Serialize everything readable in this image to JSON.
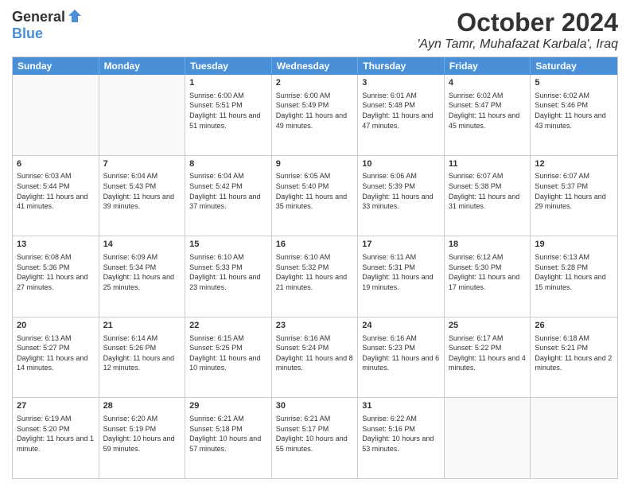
{
  "logo": {
    "general": "General",
    "blue": "Blue"
  },
  "header": {
    "month": "October 2024",
    "location": "'Ayn Tamr, Muhafazat Karbala', Iraq"
  },
  "days": [
    "Sunday",
    "Monday",
    "Tuesday",
    "Wednesday",
    "Thursday",
    "Friday",
    "Saturday"
  ],
  "rows": [
    [
      {
        "day": "",
        "info": "",
        "empty": true
      },
      {
        "day": "",
        "info": "",
        "empty": true
      },
      {
        "day": "1",
        "info": "Sunrise: 6:00 AM\nSunset: 5:51 PM\nDaylight: 11 hours and 51 minutes."
      },
      {
        "day": "2",
        "info": "Sunrise: 6:00 AM\nSunset: 5:49 PM\nDaylight: 11 hours and 49 minutes."
      },
      {
        "day": "3",
        "info": "Sunrise: 6:01 AM\nSunset: 5:48 PM\nDaylight: 11 hours and 47 minutes."
      },
      {
        "day": "4",
        "info": "Sunrise: 6:02 AM\nSunset: 5:47 PM\nDaylight: 11 hours and 45 minutes."
      },
      {
        "day": "5",
        "info": "Sunrise: 6:02 AM\nSunset: 5:46 PM\nDaylight: 11 hours and 43 minutes."
      }
    ],
    [
      {
        "day": "6",
        "info": "Sunrise: 6:03 AM\nSunset: 5:44 PM\nDaylight: 11 hours and 41 minutes."
      },
      {
        "day": "7",
        "info": "Sunrise: 6:04 AM\nSunset: 5:43 PM\nDaylight: 11 hours and 39 minutes."
      },
      {
        "day": "8",
        "info": "Sunrise: 6:04 AM\nSunset: 5:42 PM\nDaylight: 11 hours and 37 minutes."
      },
      {
        "day": "9",
        "info": "Sunrise: 6:05 AM\nSunset: 5:40 PM\nDaylight: 11 hours and 35 minutes."
      },
      {
        "day": "10",
        "info": "Sunrise: 6:06 AM\nSunset: 5:39 PM\nDaylight: 11 hours and 33 minutes."
      },
      {
        "day": "11",
        "info": "Sunrise: 6:07 AM\nSunset: 5:38 PM\nDaylight: 11 hours and 31 minutes."
      },
      {
        "day": "12",
        "info": "Sunrise: 6:07 AM\nSunset: 5:37 PM\nDaylight: 11 hours and 29 minutes."
      }
    ],
    [
      {
        "day": "13",
        "info": "Sunrise: 6:08 AM\nSunset: 5:36 PM\nDaylight: 11 hours and 27 minutes."
      },
      {
        "day": "14",
        "info": "Sunrise: 6:09 AM\nSunset: 5:34 PM\nDaylight: 11 hours and 25 minutes."
      },
      {
        "day": "15",
        "info": "Sunrise: 6:10 AM\nSunset: 5:33 PM\nDaylight: 11 hours and 23 minutes."
      },
      {
        "day": "16",
        "info": "Sunrise: 6:10 AM\nSunset: 5:32 PM\nDaylight: 11 hours and 21 minutes."
      },
      {
        "day": "17",
        "info": "Sunrise: 6:11 AM\nSunset: 5:31 PM\nDaylight: 11 hours and 19 minutes."
      },
      {
        "day": "18",
        "info": "Sunrise: 6:12 AM\nSunset: 5:30 PM\nDaylight: 11 hours and 17 minutes."
      },
      {
        "day": "19",
        "info": "Sunrise: 6:13 AM\nSunset: 5:28 PM\nDaylight: 11 hours and 15 minutes."
      }
    ],
    [
      {
        "day": "20",
        "info": "Sunrise: 6:13 AM\nSunset: 5:27 PM\nDaylight: 11 hours and 14 minutes."
      },
      {
        "day": "21",
        "info": "Sunrise: 6:14 AM\nSunset: 5:26 PM\nDaylight: 11 hours and 12 minutes."
      },
      {
        "day": "22",
        "info": "Sunrise: 6:15 AM\nSunset: 5:25 PM\nDaylight: 11 hours and 10 minutes."
      },
      {
        "day": "23",
        "info": "Sunrise: 6:16 AM\nSunset: 5:24 PM\nDaylight: 11 hours and 8 minutes."
      },
      {
        "day": "24",
        "info": "Sunrise: 6:16 AM\nSunset: 5:23 PM\nDaylight: 11 hours and 6 minutes."
      },
      {
        "day": "25",
        "info": "Sunrise: 6:17 AM\nSunset: 5:22 PM\nDaylight: 11 hours and 4 minutes."
      },
      {
        "day": "26",
        "info": "Sunrise: 6:18 AM\nSunset: 5:21 PM\nDaylight: 11 hours and 2 minutes."
      }
    ],
    [
      {
        "day": "27",
        "info": "Sunrise: 6:19 AM\nSunset: 5:20 PM\nDaylight: 11 hours and 1 minute."
      },
      {
        "day": "28",
        "info": "Sunrise: 6:20 AM\nSunset: 5:19 PM\nDaylight: 10 hours and 59 minutes."
      },
      {
        "day": "29",
        "info": "Sunrise: 6:21 AM\nSunset: 5:18 PM\nDaylight: 10 hours and 57 minutes."
      },
      {
        "day": "30",
        "info": "Sunrise: 6:21 AM\nSunset: 5:17 PM\nDaylight: 10 hours and 55 minutes."
      },
      {
        "day": "31",
        "info": "Sunrise: 6:22 AM\nSunset: 5:16 PM\nDaylight: 10 hours and 53 minutes."
      },
      {
        "day": "",
        "info": "",
        "empty": true
      },
      {
        "day": "",
        "info": "",
        "empty": true
      }
    ]
  ]
}
